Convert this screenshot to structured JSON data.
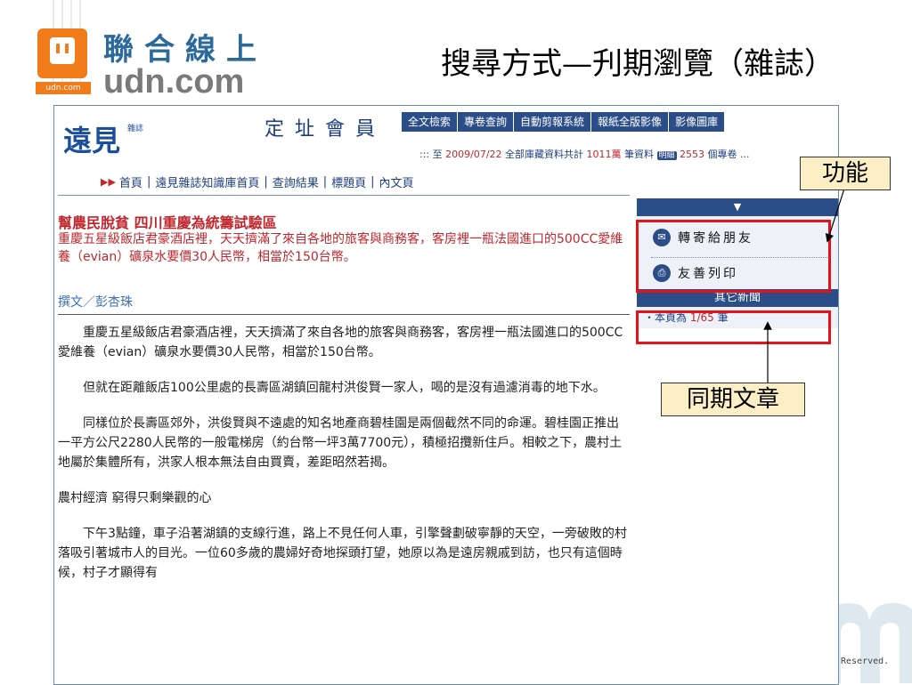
{
  "slide": {
    "title": "搜尋方式—刋期瀏覽（雜誌）",
    "footer": "Reserved."
  },
  "logo": {
    "chinese": "聯合線上",
    "english": "udn.com",
    "tag": "udn.com"
  },
  "site": {
    "brand": "遠見",
    "brand_sub": "雜誌",
    "member_title": "定址會員",
    "nav": [
      "全文檢索",
      "專卷查詢",
      "自動剪報系統",
      "報紙全版影像",
      "影像圖庫"
    ],
    "db_info": {
      "prefix": "::: 至",
      "date": "2009/07/22",
      "mid": "全部庫藏資料共計",
      "count": "1011萬",
      "mid2": "筆資料",
      "pill": "明細",
      "count2": "2553",
      "suffix": "個專卷 ..."
    },
    "breadcrumb": [
      "首頁",
      "遠見雜誌知識庫首頁",
      "查詢結果",
      "標題頁",
      "內文頁"
    ]
  },
  "article": {
    "headline": "幫農民脫貧 四川重慶為統籌試驗區",
    "lead": "重慶五星級飯店君豪酒店裡，天天擠滿了來自各地的旅客與商務客，客房裡一瓶法國進口的500CC愛維養（evian）礦泉水要價30人民幣，相當於150台幣。",
    "author": "撰文／彭杏珠",
    "paragraphs": [
      "重慶五星級飯店君豪酒店裡，天天擠滿了來自各地的旅客與商務客，客房裡一瓶法國進口的500CC愛維養（evian）礦泉水要價30人民幣，相當於150台幣。",
      "但就在距離飯店100公里處的長壽區湖鎮回龍村洪俊賢一家人，喝的是沒有過濾消毒的地下水。",
      "同樣位於長壽區郊外，洪俊賢與不遠處的知名地產商碧桂園是兩個截然不同的命運。碧桂園正推出一平方公尺2280人民幣的一般電梯房（約台幣一坪3萬7700元），積極招攬新住戶。相較之下，農村土地屬於集體所有，洪家人根本無法自由買賣，差距昭然若揭。"
    ],
    "subheading": "農村經濟 窮得只剩樂觀的心",
    "paragraph_last": "下午3點鐘，車子沿著湖鎮的支線行進，路上不見任何人車，引擎聲劃破寧靜的天空，一旁破敗的村落吸引著城市人的目光。一位60多歲的農婦好奇地探頭打望，她原以為是遠房親戚到訪，也只有這個時候，村子才顯得有"
  },
  "side": {
    "arrow": "▼",
    "forward": "轉寄給朋友",
    "print": "友善列印",
    "other_news": "其它新聞",
    "count_prefix": "・本頁為",
    "count_value": "1/65",
    "count_suffix": "筆"
  },
  "annotations": {
    "function_label": "功能",
    "same_issue_label": "同期文章"
  },
  "colors": {
    "nav_blue": "#2c4e88",
    "headline_red": "#c2272d",
    "annotation_red": "#e3121b",
    "callout_bg": "#fcefc6",
    "udn_orange": "#f07c1c"
  }
}
